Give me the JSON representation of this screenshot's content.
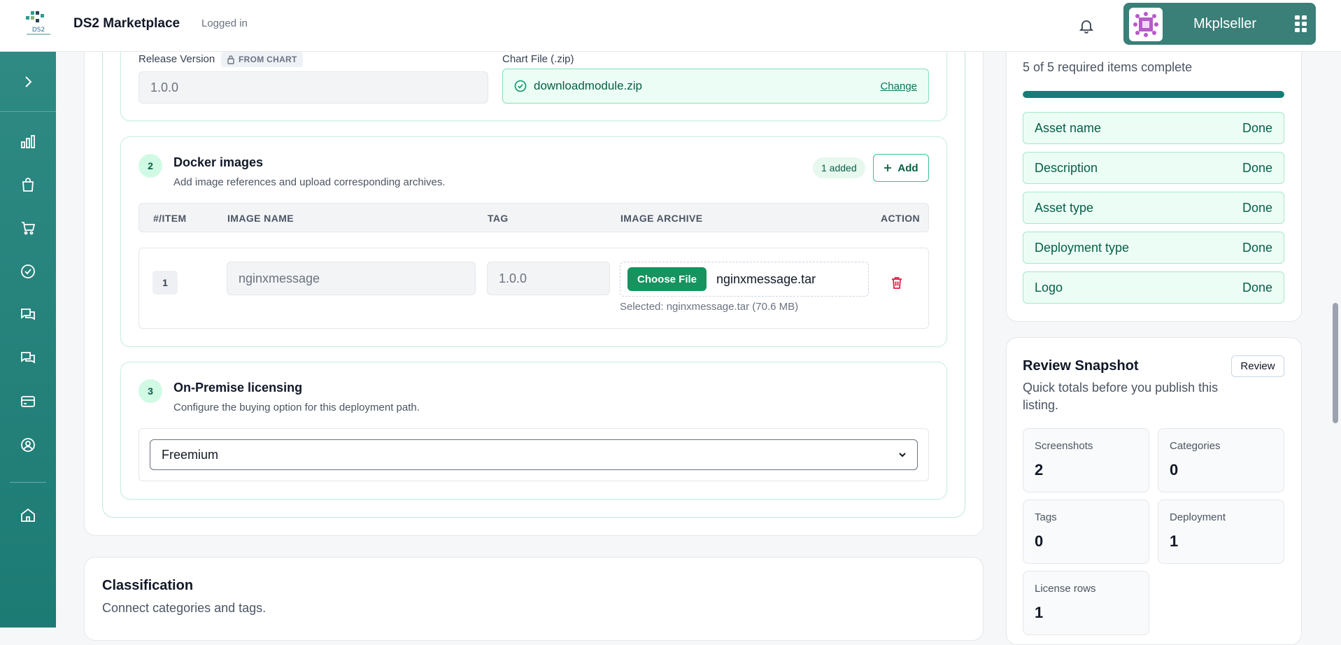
{
  "header": {
    "app_title": "DS2 Marketplace",
    "status": "Logged in",
    "user_name": "Mkplseller"
  },
  "chart_section": {
    "release_label": "Release Version",
    "release_chip": "FROM CHART",
    "release_value": "1.0.0",
    "chart_file_label": "Chart File (.zip)",
    "chart_file_name": "downloadmodule.zip",
    "change_label": "Change"
  },
  "docker_section": {
    "step": "2",
    "title": "Docker images",
    "subtitle": "Add image references and upload corresponding archives.",
    "added_badge": "1 added",
    "add_label": "Add",
    "columns": [
      "#/ITEM",
      "IMAGE NAME",
      "TAG",
      "IMAGE ARCHIVE",
      "ACTION"
    ],
    "rows": [
      {
        "index": "1",
        "image_name": "nginxmessage",
        "tag": "1.0.0",
        "choose_label": "Choose File",
        "archive_name": "nginxmessage.tar",
        "selected_note": "Selected: nginxmessage.tar (70.6 MB)"
      }
    ]
  },
  "licensing_section": {
    "step": "3",
    "title": "On-Premise licensing",
    "subtitle": "Configure the buying option for this deployment path.",
    "selected_option": "Freemium"
  },
  "classification": {
    "title": "Classification",
    "subtitle": "Connect categories and tags."
  },
  "checklist": {
    "progress_text": "5 of 5 required items complete",
    "progress": 1.0,
    "items": [
      {
        "label": "Asset name",
        "status": "Done"
      },
      {
        "label": "Description",
        "status": "Done"
      },
      {
        "label": "Asset type",
        "status": "Done"
      },
      {
        "label": "Deployment type",
        "status": "Done"
      },
      {
        "label": "Logo",
        "status": "Done"
      }
    ]
  },
  "review_snapshot": {
    "title": "Review Snapshot",
    "subtitle": "Quick totals before you publish this listing.",
    "review_label": "Review",
    "stats": [
      {
        "label": "Screenshots",
        "value": "2"
      },
      {
        "label": "Categories",
        "value": "0"
      },
      {
        "label": "Tags",
        "value": "0"
      },
      {
        "label": "Deployment",
        "value": "1"
      },
      {
        "label": "License rows",
        "value": "1"
      }
    ]
  },
  "colors": {
    "brand": "#1c7b74",
    "accent_green": "#16935e",
    "success_bg": "#ecfdf5",
    "danger": "#e11d48"
  }
}
